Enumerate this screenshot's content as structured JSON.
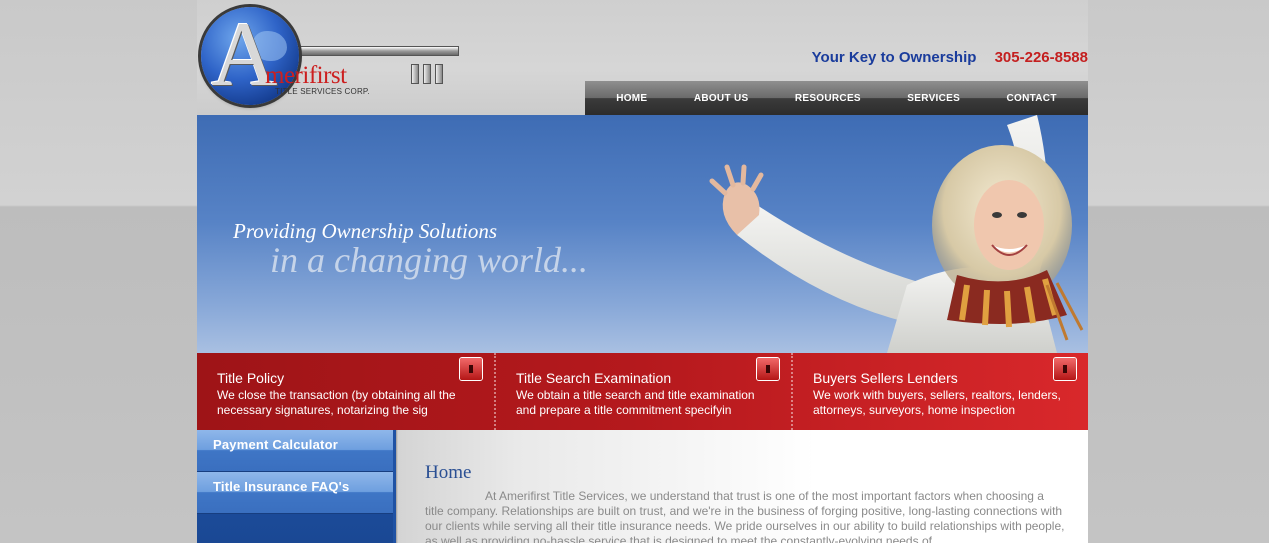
{
  "brand": {
    "logo_name": "merifirst",
    "logo_letter": "A",
    "logo_sub": "TITLE SERVICES CORP."
  },
  "header": {
    "tagline": "Your Key to Ownership",
    "phone": "305-226-8588"
  },
  "nav": {
    "items": [
      {
        "label": "HOME"
      },
      {
        "label": "ABOUT US"
      },
      {
        "label": "RESOURCES"
      },
      {
        "label": "SERVICES"
      },
      {
        "label": "CONTACT"
      }
    ]
  },
  "hero": {
    "line1": "Providing Ownership Solutions",
    "line2": "in a changing world..."
  },
  "features": [
    {
      "title": "Title Policy",
      "desc": "We close the transaction (by obtaining all the necessary signatures, notarizing the sig"
    },
    {
      "title": "Title Search Examination",
      "desc": "We obtain a title search and title examination and prepare a title commitment specifyin"
    },
    {
      "title": "Buyers Sellers Lenders",
      "desc": "We work with buyers, sellers, realtors, lenders, attorneys, surveyors, home inspection"
    }
  ],
  "sidebar": {
    "items": [
      {
        "label": "Payment Calculator"
      },
      {
        "label": "Title Insurance FAQ's"
      }
    ]
  },
  "main": {
    "heading": "Home",
    "body": "At Amerifirst Title Services, we understand that trust is one of the most important factors when choosing a title company. Relationships are built on trust, and we're in the business of forging positive, long-lasting connections with our clients while serving all their title insurance needs. We pride ourselves in our ability to build relationships with people, as well as providing no-hassle service that is designed to meet the constantly-evolving needs of"
  },
  "colors": {
    "brand_red": "#c41f1f",
    "brand_blue": "#1a3c9c",
    "feature_red": "#b5191d"
  }
}
